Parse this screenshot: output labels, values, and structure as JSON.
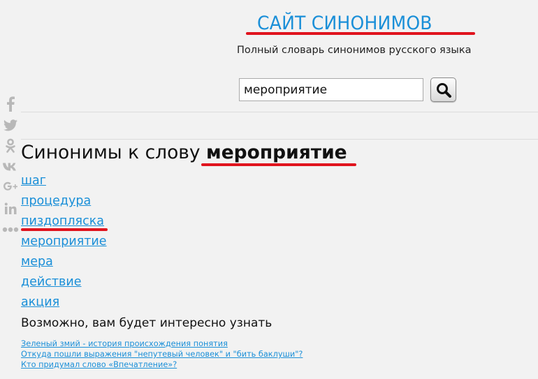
{
  "header": {
    "site_title": "САЙТ СИНОНИМОВ",
    "subtitle": "Полный словарь синонимов русского языка"
  },
  "search": {
    "value": "мероприятие",
    "button_icon": "search-icon"
  },
  "social": {
    "icons": [
      "facebook-icon",
      "twitter-icon",
      "odnoklassniki-icon",
      "vk-icon",
      "google-plus-icon",
      "linkedin-icon",
      "more-icon"
    ]
  },
  "main": {
    "heading_prefix": "Синонимы к слову",
    "heading_word": "мероприятие",
    "synonyms": [
      "шаг",
      "процедура",
      "пиздопляска",
      "мероприятие",
      "мера",
      "действие",
      "акция"
    ],
    "related_title": "Возможно, вам будет интересно узнать",
    "related_links": [
      "Зеленый змий - история происхождения понятия",
      "Откуда пошли выражения \"непутевый человек\" и \"бить баклуши\"?",
      "Кто придумал слово «Впечатление»?"
    ]
  },
  "colors": {
    "link": "#1a8fd8",
    "highlight_underline": "#e0141e",
    "background": "#f2f2f2"
  }
}
